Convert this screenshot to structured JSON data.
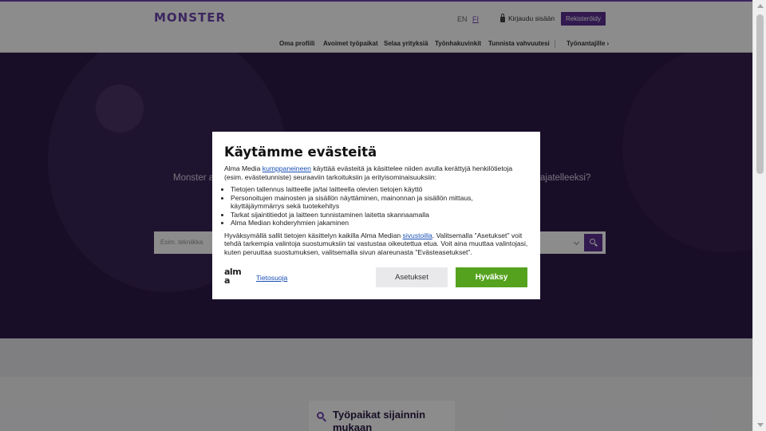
{
  "header": {
    "logo": "MONSTER",
    "lang_en": "EN",
    "lang_fi": "FI",
    "login": "Kirjaudu sisään",
    "register": "Rekisteröidy",
    "nav": [
      "Oma profiili",
      "Avoimet työpaikat",
      "Selaa yrityksiä",
      "Työnhakuvinkit",
      "Tunnista vahvuutesi"
    ],
    "employers": "Työnantajille ›"
  },
  "hero": {
    "text_left": "Monster a",
    "text_right": "ajatelleeksi?",
    "search_placeholder": "Esim. tekniikka"
  },
  "card": {
    "title": "Työpaikat sijainnin mukaan"
  },
  "dialog": {
    "title": "Käytämme evästeitä",
    "intro_before": "Alma Media ",
    "intro_link": "kumppaneineen",
    "intro_after": " käyttää evästeitä ja käsittelee niiden avulla kerättyjä henkilötietoja (esim. evästetunniste) seuraaviin tarkoituksiin ja erityisominaisuuksiin:",
    "purposes": [
      "Tietojen tallennus laitteelle ja/tai laitteella olevien tietojen käyttö",
      "Personoitujen mainosten ja sisällön näyttäminen, mainonnan ja sisällön mittaus, käyttäjäymmärrys sekä tuotekehitys",
      "Tarkat sijaintitiedot ja laitteen tunnistaminen laitetta skannaamalla",
      "Alma Median kohderyhmien jakaminen"
    ],
    "consent_before": "Hyväksymällä sallit tietojen käsittelyn kaikilla Alma Median ",
    "consent_link": "sivustoilla",
    "consent_after": ". Valitsemalla \"Asetukset\" voit tehdä tarkempia valintoja suostumuksiin tai vastustaa oikeutettua etua. Voit aina muuttaa valintojasi, kuten peruuttaa suostumuksen, valitsemalla sivun alareunasta \"Evästeasetukset\".",
    "brand_top": "alm",
    "brand_bottom": "a",
    "privacy": "Tietosuoja",
    "settings_button": "Asetukset",
    "accept_button": "Hyväksy"
  }
}
